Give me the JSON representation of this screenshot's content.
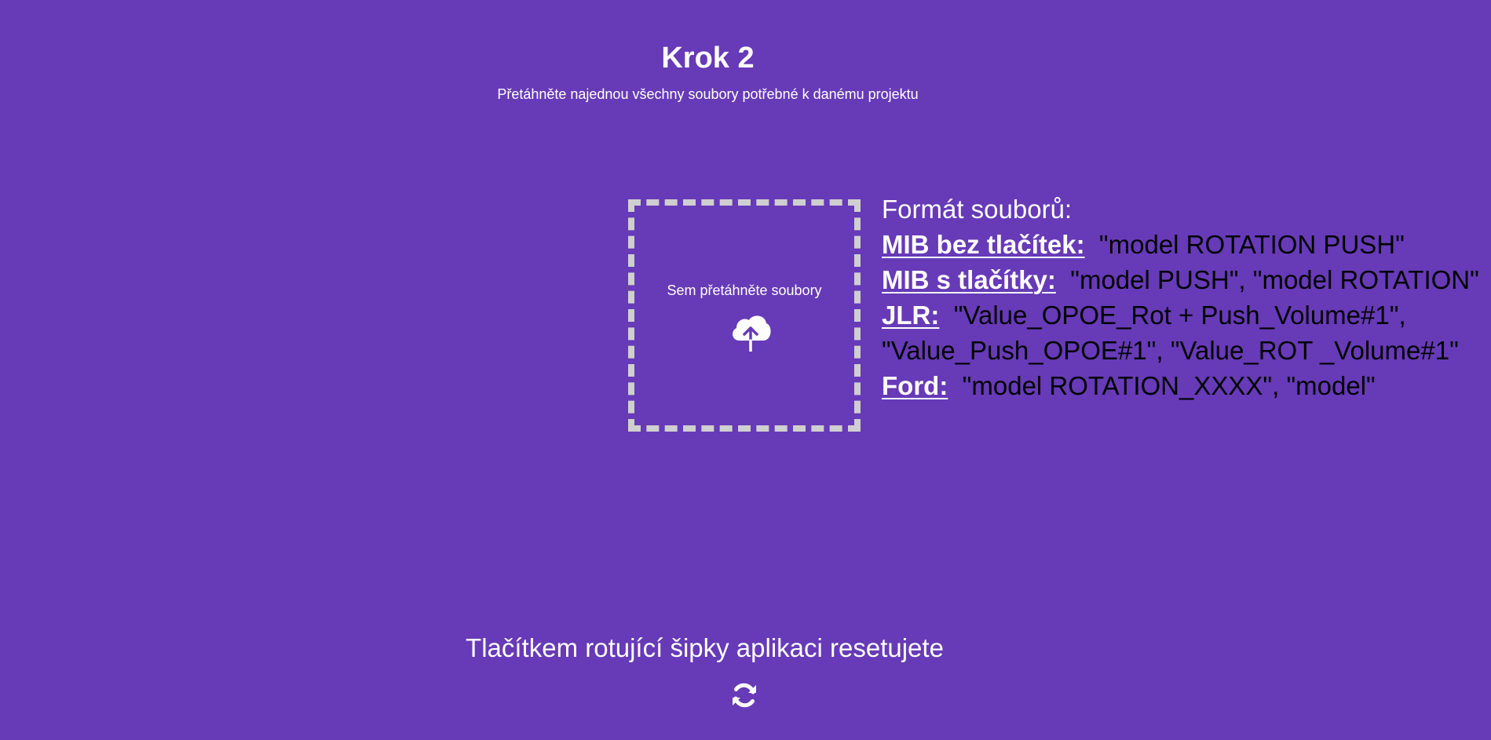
{
  "header": {
    "title": "Krok 2",
    "subtitle": "Přetáhněte najednou všechny soubory potřebné k danému projektu"
  },
  "dropzone": {
    "label": "Sem přetáhněte soubory",
    "icon": "cloud-upload-icon"
  },
  "formats": {
    "heading": "Formát souborů:",
    "items": [
      {
        "brand": "MIB bez tlačítek:",
        "values": "\"model ROTATION PUSH\""
      },
      {
        "brand": "MIB s tlačítky:",
        "values": "\"model PUSH\", \"model ROTATION\""
      },
      {
        "brand": "JLR:",
        "values": "\"Value_OPOE_Rot + Push_Volume#1\",",
        "continuation": "\"Value_Push_OPOE#1\", \"Value_ROT _Volume#1\""
      },
      {
        "brand": "Ford:",
        "values": "\"model ROTATION_XXXX\", \"model\""
      }
    ]
  },
  "reset": {
    "text": "Tlačítkem rotující šipky aplikaci resetujete",
    "icon": "refresh-icon"
  },
  "colors": {
    "background": "#673ab7",
    "text": "#ffffff",
    "format_values": "#000000",
    "dropzone_border": "#cfcfcf"
  }
}
